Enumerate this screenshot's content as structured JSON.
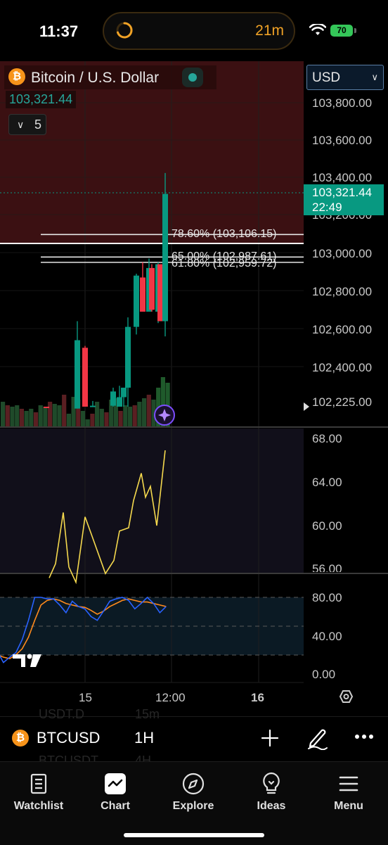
{
  "status": {
    "time": "11:37",
    "activity": "21m",
    "battery": "70"
  },
  "header": {
    "title": "Bitcoin / U.S. Dollar",
    "last_price": "103,321.44",
    "collapse_count": "5",
    "currency": "USD"
  },
  "price_axis": [
    "103,800.00",
    "103,600.00",
    "103,400.00",
    "103,200.00",
    "103,000.00",
    "102,800.00",
    "102,600.00",
    "102,400.00",
    "102,225.00"
  ],
  "price_tag": {
    "price": "103,321.44",
    "countdown": "22:49"
  },
  "fib_levels": [
    "78.60% (103,106.15)",
    "65.00% (102,987.61)",
    "61.80% (102,959.72)"
  ],
  "rsi_axis": [
    "68.00",
    "64.00",
    "60.00",
    "56.00"
  ],
  "stoch_axis": [
    "80.00",
    "40.00",
    "0.00"
  ],
  "time_axis": [
    "15",
    "12:00",
    "16"
  ],
  "symbol_bar": {
    "symbol": "BTCUSD",
    "interval": "1H",
    "ghost_items": [
      "USDT.D",
      "15m",
      "BTCUSDT",
      "4H"
    ]
  },
  "tabs": [
    "Watchlist",
    "Chart",
    "Explore",
    "Ideas",
    "Menu"
  ],
  "colors": {
    "up": "#089981",
    "down": "#f23645",
    "rsi": "#f5d94e",
    "stoch_k": "#2962ff",
    "stoch_d": "#ff8a1d",
    "highlight": "#3b1012"
  },
  "chart_data": {
    "type": "candlestick",
    "candles": [
      {
        "open": 102200,
        "high": 102200,
        "low": 102200,
        "close": 102200,
        "dir": "down"
      },
      {
        "open": 102190,
        "high": 102650,
        "low": 102190,
        "close": 102550,
        "dir": "up"
      },
      {
        "open": 102510,
        "high": 102520,
        "low": 102200,
        "close": 102200,
        "dir": "down"
      },
      {
        "open": 102200,
        "high": 102230,
        "low": 102200,
        "close": 102205,
        "dir": "up"
      },
      {
        "open": 102205,
        "high": 102300,
        "low": 102200,
        "close": 102280,
        "dir": "up"
      },
      {
        "open": 102200,
        "high": 102310,
        "low": 102200,
        "close": 102250,
        "dir": "up"
      },
      {
        "open": 102250,
        "high": 102300,
        "low": 102200,
        "close": 102300,
        "dir": "up"
      },
      {
        "open": 102300,
        "high": 102670,
        "low": 102200,
        "close": 102620,
        "dir": "up"
      },
      {
        "open": 102620,
        "high": 102900,
        "low": 102580,
        "close": 102890,
        "dir": "up"
      },
      {
        "open": 102880,
        "high": 102960,
        "low": 102700,
        "close": 102700,
        "dir": "down"
      },
      {
        "open": 102700,
        "high": 102980,
        "low": 102700,
        "close": 102930,
        "dir": "up"
      },
      {
        "open": 102930,
        "high": 102950,
        "low": 102700,
        "close": 102710,
        "dir": "down"
      },
      {
        "open": 102700,
        "high": 102960,
        "low": 102640,
        "close": 102950,
        "dir": "up"
      },
      {
        "open": 102950,
        "high": 102950,
        "low": 102650,
        "close": 102650,
        "dir": "down"
      },
      {
        "open": 102650,
        "high": 103430,
        "low": 102570,
        "close": 103320,
        "dir": "up"
      }
    ],
    "fib_prices": [
      103106.15,
      102987.61,
      102959.72
    ],
    "rsi_values": [
      55.2,
      56.5,
      61.2,
      56.2,
      54.8,
      60.8,
      59.2,
      55.6,
      56.8,
      59.5,
      59.8,
      62.3,
      64.8,
      62.6,
      63.6,
      60.0,
      66.9
    ],
    "stoch_k": [
      30,
      15,
      22,
      28,
      45,
      70,
      100,
      100,
      98,
      98,
      90,
      80,
      95,
      88,
      85,
      75,
      70,
      82,
      95,
      98,
      100,
      96,
      85,
      92,
      100,
      92,
      80,
      88
    ],
    "stoch_d": [
      25,
      22,
      20,
      25,
      33,
      48,
      70,
      90,
      96,
      98,
      96,
      92,
      90,
      88,
      87,
      83,
      78,
      82,
      88,
      92,
      96,
      98,
      96,
      94,
      94,
      92,
      90,
      88
    ],
    "volume": [
      35,
      30,
      28,
      30,
      25,
      22,
      25,
      20,
      30,
      28,
      35,
      32,
      30,
      45,
      18,
      42,
      38,
      22,
      10,
      18,
      35,
      25,
      20,
      38,
      40,
      22,
      30,
      28,
      30,
      35,
      40,
      45,
      38,
      55,
      70,
      62
    ]
  }
}
